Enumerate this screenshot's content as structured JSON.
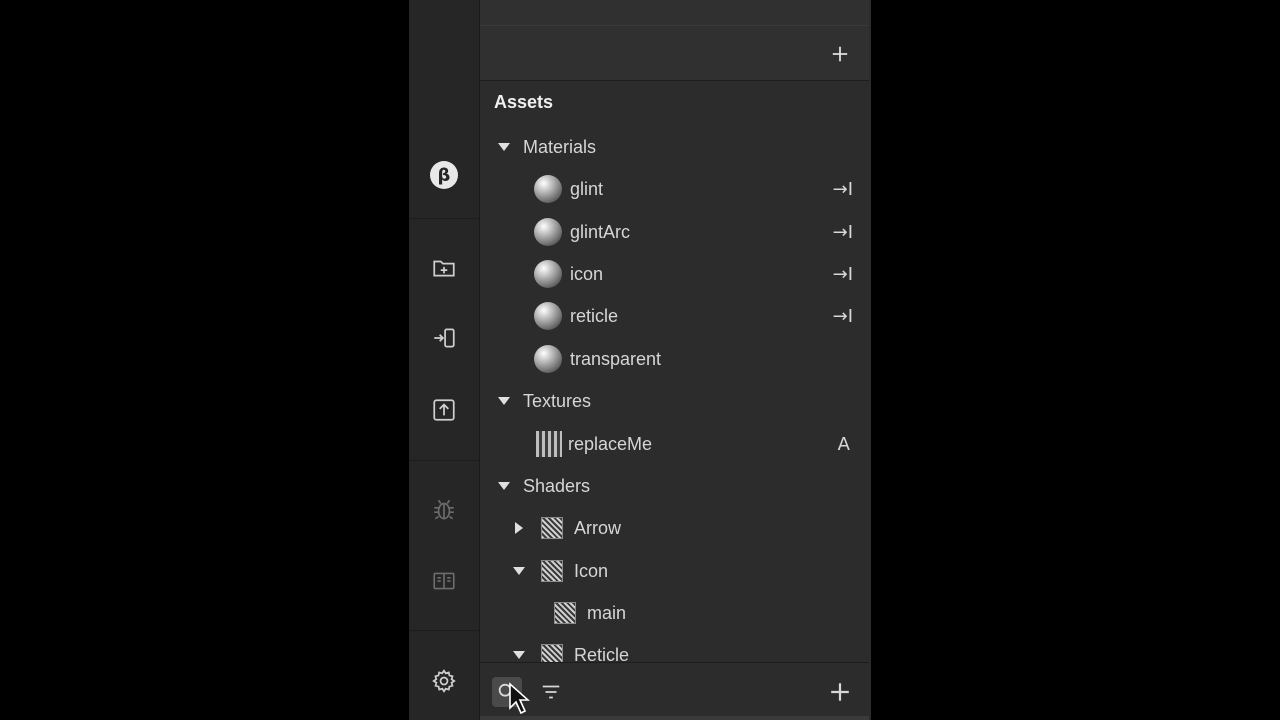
{
  "iconbar": {
    "beta_glyph": "β",
    "items": [
      "beta-icon",
      "new-folder-icon",
      "sign-in-icon",
      "upload-icon",
      "bug-icon",
      "book-icon",
      "gear-icon"
    ]
  },
  "toppanel": {
    "add_icon": "plus-icon"
  },
  "assets": {
    "title": "Assets",
    "materials": {
      "label": "Materials",
      "items": [
        {
          "name": "glint",
          "action": "→I"
        },
        {
          "name": "glintArc",
          "action": "→I"
        },
        {
          "name": "icon",
          "action": "→I"
        },
        {
          "name": "reticle",
          "action": "→I"
        },
        {
          "name": "transparent",
          "action": ""
        }
      ]
    },
    "textures": {
      "label": "Textures",
      "items": [
        {
          "name": "replaceMe",
          "action": "A"
        }
      ]
    },
    "shaders": {
      "label": "Shaders",
      "items": [
        {
          "name": "Arrow",
          "expanded": false
        },
        {
          "name": "Icon",
          "expanded": true,
          "children": [
            "main"
          ]
        },
        {
          "name": "Reticle",
          "expanded": true
        }
      ]
    }
  },
  "bottombar": {
    "icons": [
      "search-icon",
      "filter-icon",
      "plus-icon"
    ]
  },
  "colors": {
    "panel_bg": "#2c2c2c",
    "iconbar_bg": "#262626",
    "text": "#d6d6d6"
  }
}
